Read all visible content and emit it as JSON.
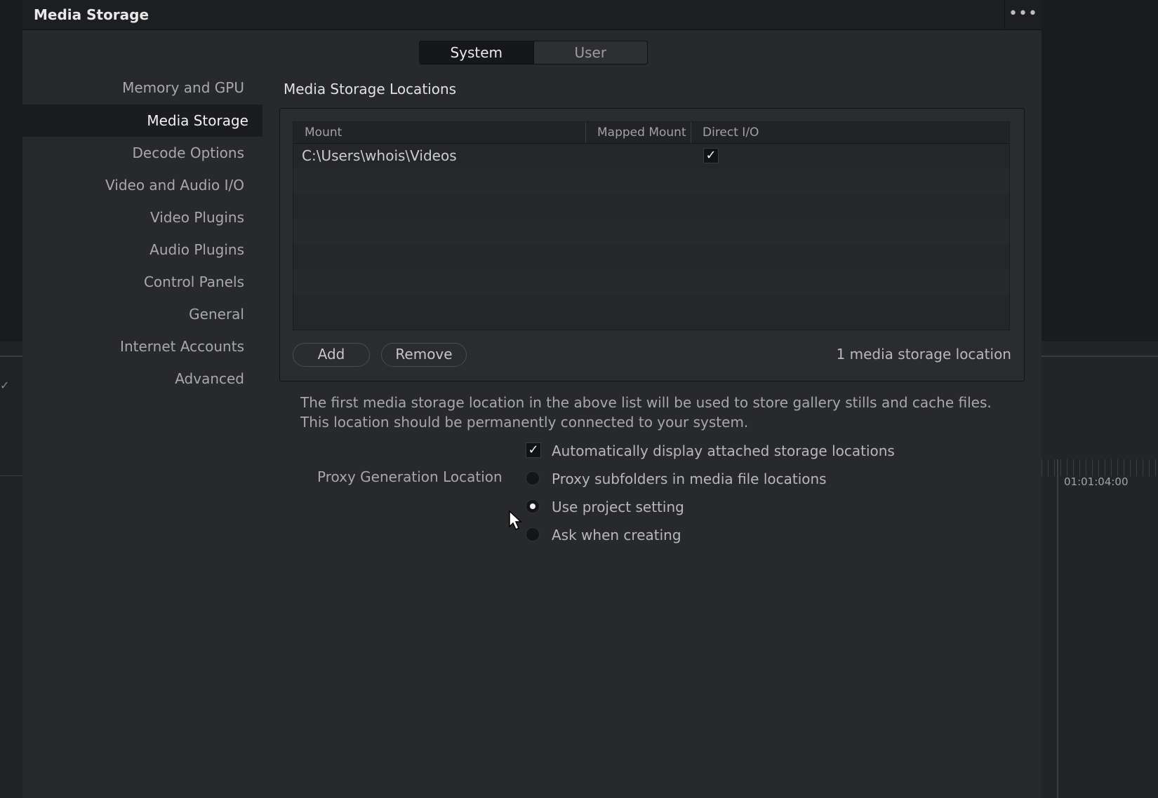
{
  "window": {
    "title": "Media Storage",
    "more_icon": "..."
  },
  "tabs": [
    "System",
    "User"
  ],
  "sidebar": {
    "items": [
      {
        "label": "Memory and GPU"
      },
      {
        "label": "Media Storage",
        "active": true
      },
      {
        "label": "Decode Options"
      },
      {
        "label": "Video and Audio I/O"
      },
      {
        "label": "Video Plugins"
      },
      {
        "label": "Audio Plugins"
      },
      {
        "label": "Control Panels"
      },
      {
        "label": "General"
      },
      {
        "label": "Internet Accounts"
      },
      {
        "label": "Advanced"
      }
    ]
  },
  "main": {
    "section_title": "Media Storage Locations",
    "table": {
      "columns": [
        "Mount",
        "Mapped Mount",
        "Direct I/O"
      ],
      "rows": [
        {
          "mount": "C:\\Users\\whois\\Videos",
          "mapped_mount": "",
          "direct_io": true
        }
      ]
    },
    "add_label": "Add",
    "remove_label": "Remove",
    "count_text": "1 media storage location",
    "note": "The first media storage location in the above list will be used to store gallery stills and cache files. This location should be permanently connected to your system.",
    "auto_display": {
      "label": "Automatically display attached storage locations",
      "checked": true
    },
    "proxy": {
      "label": "Proxy Generation Location",
      "options": [
        {
          "label": "Proxy subfolders in media file locations",
          "selected": false
        },
        {
          "label": "Use project setting",
          "selected": true
        },
        {
          "label": "Ask when creating",
          "selected": false
        }
      ]
    }
  },
  "background": {
    "timecode": "01:01:04:00"
  },
  "colors": {
    "dialog_bg": "#28292d",
    "titlebar_bg": "#1d1e21",
    "active_item_bg": "#1b1c1f"
  }
}
